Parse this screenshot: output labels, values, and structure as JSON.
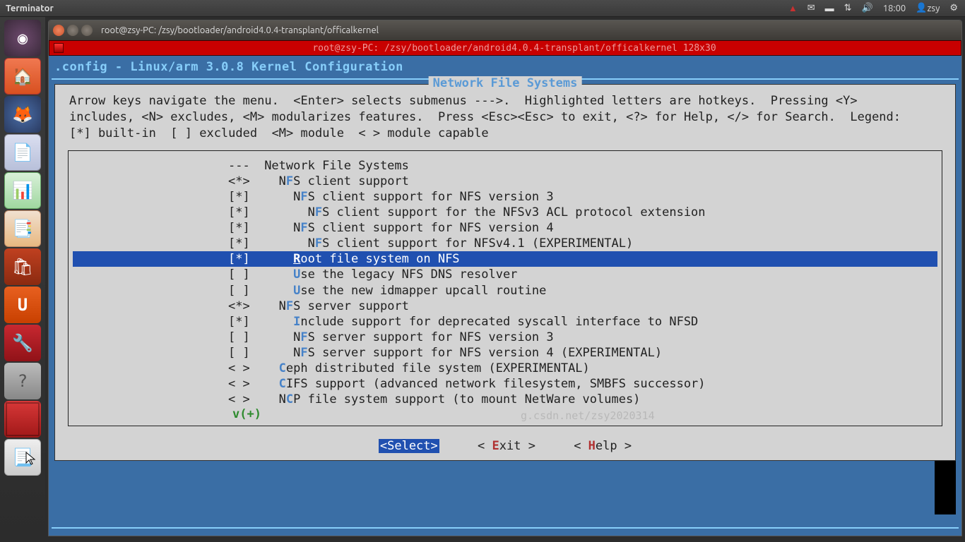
{
  "panel": {
    "app": "Terminator",
    "time": "18:00",
    "user": "zsy"
  },
  "launcher_tooltip": "Terminator",
  "window": {
    "title": "root@zsy-PC: /zsy/bootloader/android4.0.4-transplant/officalkernel",
    "tab_title": "root@zsy-PC: /zsy/bootloader/android4.0.4-transplant/officalkernel 128x30"
  },
  "config_title": ".config - Linux/arm 3.0.8 Kernel Configuration",
  "menubox_title": "Network File Systems",
  "help_lines": [
    "Arrow keys navigate the menu.  <Enter> selects submenus --->.  Highlighted letters are hotkeys.  Pressing <Y>",
    "includes, <N> excludes, <M> modularizes features.  Press <Esc><Esc> to exit, <?> for Help, </> for Search.  Legend:",
    "[*] built-in  [ ] excluded  <M> module  < > module capable"
  ],
  "items": [
    {
      "mark": "---",
      "pre": "",
      "hk": "",
      "label": "Network File Systems",
      "sel": false,
      "indent": 0
    },
    {
      "mark": "<*>",
      "pre": "N",
      "hk": "F",
      "label": "S client support",
      "sel": false,
      "indent": 1
    },
    {
      "mark": "[*]",
      "pre": "N",
      "hk": "F",
      "label": "S client support for NFS version 3",
      "sel": false,
      "indent": 2
    },
    {
      "mark": "[*]",
      "pre": "N",
      "hk": "F",
      "label": "S client support for the NFSv3 ACL protocol extension",
      "sel": false,
      "indent": 3
    },
    {
      "mark": "[*]",
      "pre": "N",
      "hk": "F",
      "label": "S client support for NFS version 4",
      "sel": false,
      "indent": 2
    },
    {
      "mark": "[*]",
      "pre": "N",
      "hk": "F",
      "label": "S client support for NFSv4.1 (EXPERIMENTAL)",
      "sel": false,
      "indent": 3
    },
    {
      "mark": "[*]",
      "pre": "",
      "hk": "R",
      "label": "oot file system on NFS",
      "sel": true,
      "indent": 2
    },
    {
      "mark": "[ ]",
      "pre": "",
      "hk": "U",
      "label": "se the legacy NFS DNS resolver",
      "sel": false,
      "indent": 2
    },
    {
      "mark": "[ ]",
      "pre": "",
      "hk": "U",
      "label": "se the new idmapper upcall routine",
      "sel": false,
      "indent": 2
    },
    {
      "mark": "<*>",
      "pre": "N",
      "hk": "F",
      "label": "S server support",
      "sel": false,
      "indent": 1
    },
    {
      "mark": "[*]",
      "pre": "",
      "hk": "I",
      "label": "nclude support for deprecated syscall interface to NFSD",
      "sel": false,
      "indent": 2
    },
    {
      "mark": "[ ]",
      "pre": "N",
      "hk": "F",
      "label": "S server support for NFS version 3",
      "sel": false,
      "indent": 2
    },
    {
      "mark": "[ ]",
      "pre": "N",
      "hk": "F",
      "label": "S server support for NFS version 4 (EXPERIMENTAL)",
      "sel": false,
      "indent": 2
    },
    {
      "mark": "< >",
      "pre": "",
      "hk": "C",
      "label": "eph distributed file system (EXPERIMENTAL)",
      "sel": false,
      "indent": 1
    },
    {
      "mark": "< >",
      "pre": "",
      "hk": "C",
      "label": "IFS support (advanced network filesystem, SMBFS successor)",
      "sel": false,
      "indent": 1
    },
    {
      "mark": "< >",
      "pre": "N",
      "hk": "C",
      "label": "P file system support (to mount NetWare volumes)",
      "sel": false,
      "indent": 1
    }
  ],
  "more": "v(+)",
  "buttons": {
    "select": "<Select>",
    "exit_pre": "< ",
    "exit_hk": "E",
    "exit_post": "xit >",
    "help_pre": "< ",
    "help_hk": "H",
    "help_post": "elp >"
  },
  "watermark": "g.csdn.net/zsy2020314"
}
